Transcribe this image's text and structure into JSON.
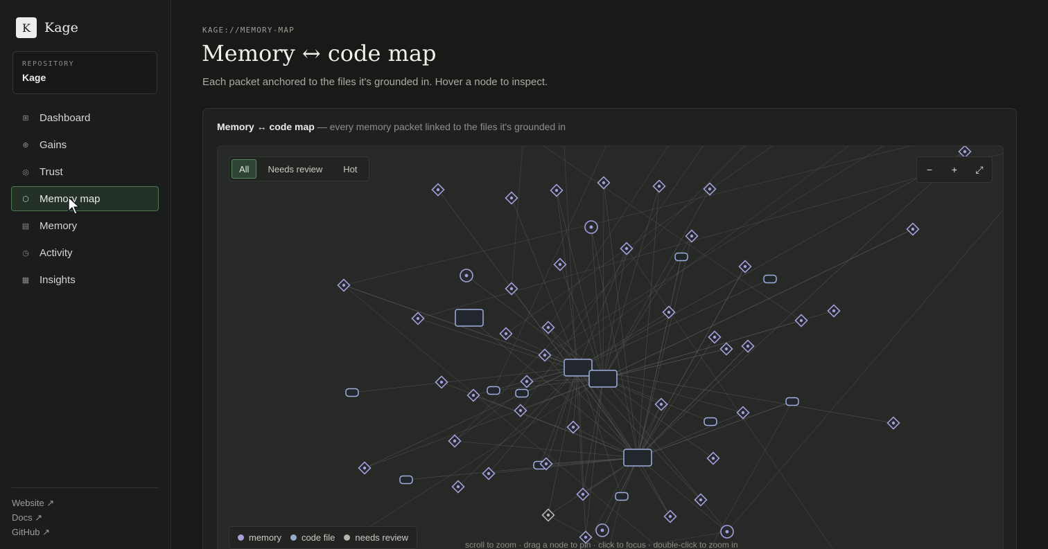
{
  "brand": {
    "logo_letter": "K",
    "name": "Kage"
  },
  "repository": {
    "label": "REPOSITORY",
    "name": "Kage"
  },
  "nav": {
    "items": [
      {
        "label": "Dashboard",
        "icon": "grid-icon"
      },
      {
        "label": "Gains",
        "icon": "plus-circle-icon"
      },
      {
        "label": "Trust",
        "icon": "ring-icon"
      },
      {
        "label": "Memory map",
        "icon": "hexagon-icon",
        "active": true
      },
      {
        "label": "Memory",
        "icon": "list-icon"
      },
      {
        "label": "Activity",
        "icon": "clock-icon"
      },
      {
        "label": "Insights",
        "icon": "table-icon"
      }
    ]
  },
  "footer_links": [
    "Website ↗",
    "Docs ↗",
    "GitHub ↗"
  ],
  "page": {
    "breadcrumb": "KAGE://MEMORY-MAP",
    "title": "Memory ↔ code map",
    "subtitle": "Each packet anchored to the files it's grounded in. Hover a node to inspect."
  },
  "panel": {
    "title": "Memory ↔ code map",
    "description": " — every memory packet linked to the files it's grounded in"
  },
  "filters": {
    "all": "All",
    "needs_review": "Needs review",
    "hot": "Hot",
    "active": "All"
  },
  "zoom": {
    "out": "−",
    "in": "+",
    "fit": "⤢"
  },
  "legend": [
    {
      "label": "memory",
      "color": "#a79fd8"
    },
    {
      "label": "code file",
      "color": "#9aa8c8"
    },
    {
      "label": "needs review",
      "color": "#b5b5b0"
    }
  ],
  "hint": "scroll to zoom · drag a node to pin · click to focus · double-click to zoom in",
  "colors": {
    "accent": "#4e7a58",
    "memory": "#a79fd8",
    "file": "#9fb0df",
    "edge": "#5c5e5b"
  }
}
